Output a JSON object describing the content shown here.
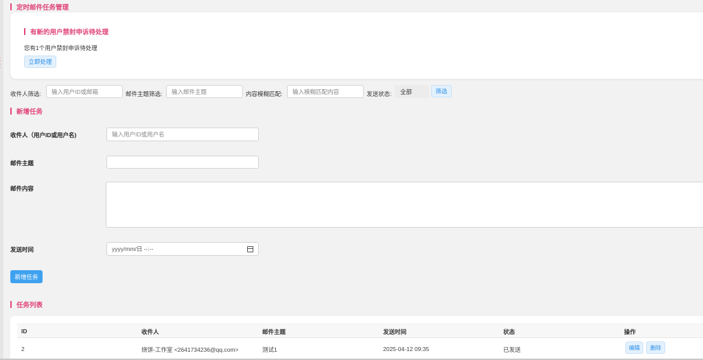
{
  "page": {
    "title": "定时邮件任务管理"
  },
  "notice": {
    "title": "有新的用户禁封申诉待处理",
    "text": "您有1个用户禁封申诉待处理",
    "button": "立即处理"
  },
  "filters": {
    "recipient_label": "收件人筛选:",
    "recipient_placeholder": "输入用户ID或邮箱",
    "subject_label": "邮件主题筛选:",
    "subject_placeholder": "输入邮件主题",
    "content_label": "内容模糊匹配:",
    "content_placeholder": "输入模糊匹配内容",
    "status_label": "发送状态:",
    "status_value": "全部",
    "button": "筛选"
  },
  "new_task": {
    "title": "新增任务",
    "recipient_label": "收件人（用户ID或用户名)",
    "recipient_placeholder": "输入用户ID或用户名",
    "subject_label": "邮件主题",
    "content_label": "邮件内容",
    "time_label": "发送时间",
    "time_placeholder": "yyyy/mm/日 --:--",
    "submit": "新增任务"
  },
  "task_list": {
    "title": "任务列表",
    "columns": [
      "ID",
      "收件人",
      "邮件主题",
      "发送时间",
      "状态",
      "操作"
    ],
    "rows": [
      {
        "id": "2",
        "recipient": "烧饼-工作室 <2641734236@qq.com>",
        "subject": "测试1",
        "time": "2025-04-12 09:35",
        "status": "已发送",
        "edit": "编辑",
        "delete": "删除"
      }
    ]
  },
  "colors": {
    "accent_pink": "#e0457b",
    "primary_blue": "#3fa2f0",
    "light_blue_bg": "#e3f1fd"
  }
}
